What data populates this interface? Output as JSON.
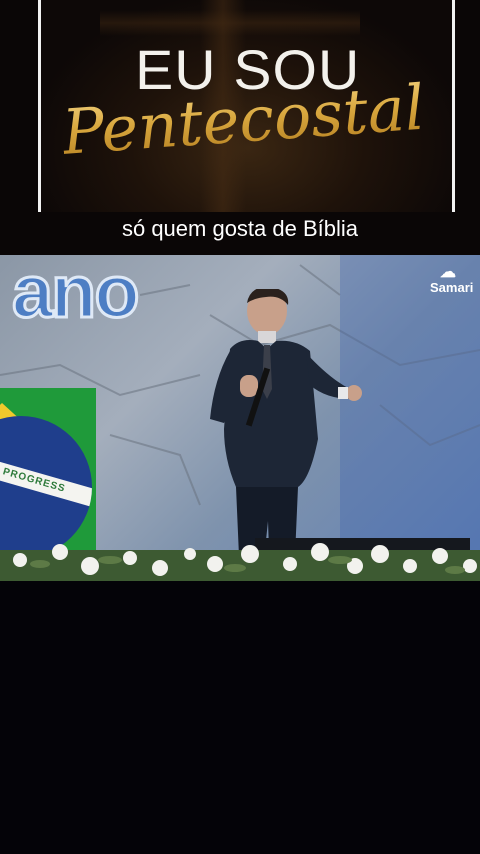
{
  "header": {
    "title_line1": "EU SOU",
    "title_line2": "Pentecostal",
    "caption": "só quem gosta de Bíblia"
  },
  "video": {
    "background_logo_text": "ano",
    "watermark": "Samari",
    "flag_motto": "EM E PROGRESS"
  },
  "colors": {
    "gold": "#d9a83f",
    "stone_blue": "#5f7fb4",
    "background": "#030206"
  }
}
